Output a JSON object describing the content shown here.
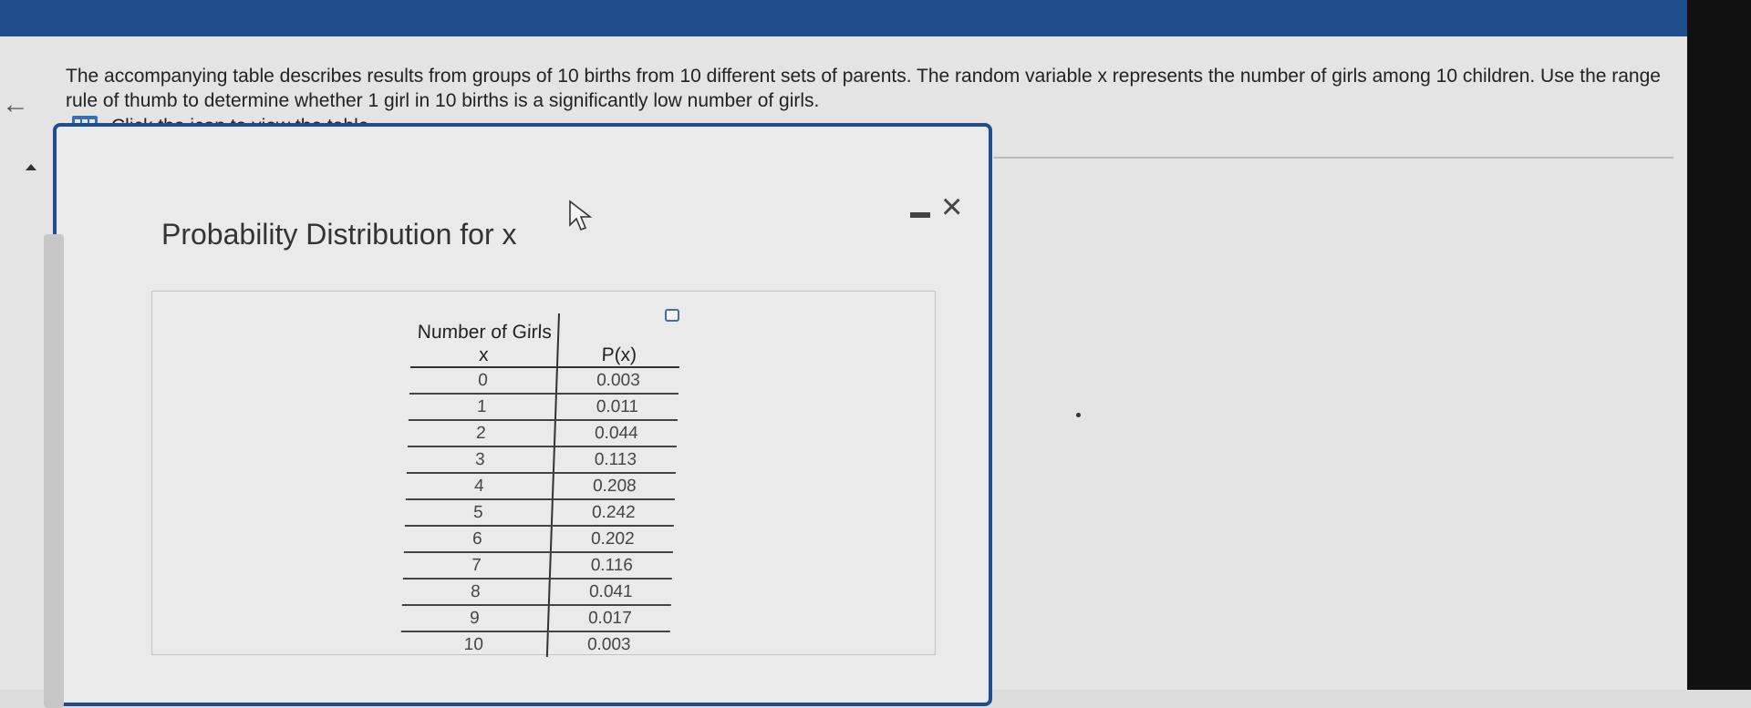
{
  "question": {
    "text": "The accompanying table describes results from groups of 10 births from 10 different sets of parents. The random variable x represents the number of girls among 10 children. Use the range rule of thumb to determine whether 1 girl in 10 births is a significantly low number of girls.",
    "table_link": "Click the icon to view the table."
  },
  "popup": {
    "title": "Probability Distribution for x",
    "table": {
      "headers": [
        "Number of Girls x",
        "P(x)"
      ],
      "rows": [
        [
          "0",
          "0.003"
        ],
        [
          "1",
          "0.011"
        ],
        [
          "2",
          "0.044"
        ],
        [
          "3",
          "0.113"
        ],
        [
          "4",
          "0.208"
        ],
        [
          "5",
          "0.242"
        ],
        [
          "6",
          "0.202"
        ],
        [
          "7",
          "0.116"
        ],
        [
          "8",
          "0.041"
        ],
        [
          "9",
          "0.017"
        ],
        [
          "10",
          "0.003"
        ]
      ]
    },
    "icons": {
      "minimize": "minimize-icon",
      "close": "close-icon"
    }
  },
  "colors": {
    "accent": "#1f4e8c",
    "background": "#e4e4e4"
  }
}
